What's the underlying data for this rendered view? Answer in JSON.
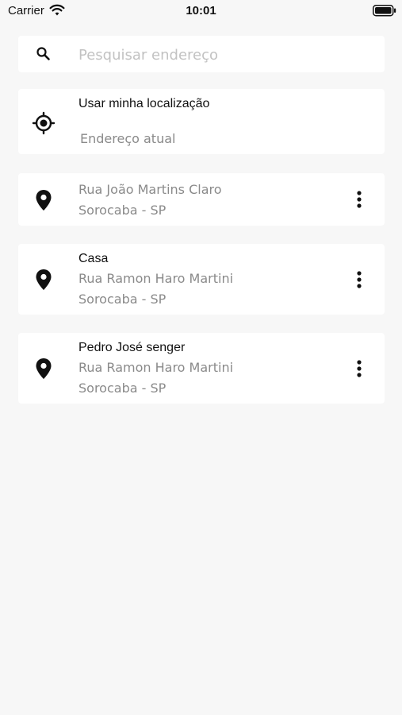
{
  "status_bar": {
    "carrier": "Carrier",
    "time": "10:01"
  },
  "search": {
    "placeholder": "Pesquisar endereço",
    "icon": "search-icon"
  },
  "current_location": {
    "title": "Usar minha localização",
    "subtitle": "Endereço atual",
    "icon": "crosshair-icon"
  },
  "addresses": [
    {
      "name": "",
      "street": "Rua João Martins Claro",
      "city": "Sorocaba - SP"
    },
    {
      "name": "Casa",
      "street": "Rua Ramon Haro Martini",
      "city": "Sorocaba - SP"
    },
    {
      "name": "Pedro José senger",
      "street": "Rua Ramon Haro Martini",
      "city": "Sorocaba - SP"
    }
  ],
  "colors": {
    "background": "#f7f7f7",
    "card": "#ffffff",
    "secondary_text": "#8a8a8a",
    "placeholder": "#c2c2c2"
  }
}
